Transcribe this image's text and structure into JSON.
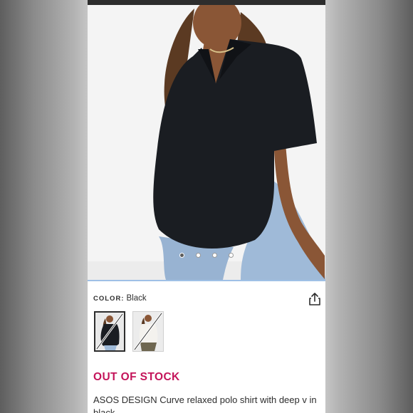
{
  "product": {
    "color_label": "COLOR:",
    "color_value": "Black",
    "stock_status": "OUT OF STOCK",
    "title": "ASOS DESIGN Curve relaxed polo shirt with deep v in black"
  },
  "gallery": {
    "image_count": 4,
    "active_index": 0
  },
  "swatches": [
    {
      "name": "Black",
      "unavailable": true,
      "selected": true
    },
    {
      "name": "White",
      "unavailable": true,
      "selected": false
    }
  ],
  "colors": {
    "stock_status": "#c4145a",
    "topbar": "#2d2d2d",
    "text": "#2d2d2d"
  },
  "icons": {
    "share": "share-icon"
  }
}
